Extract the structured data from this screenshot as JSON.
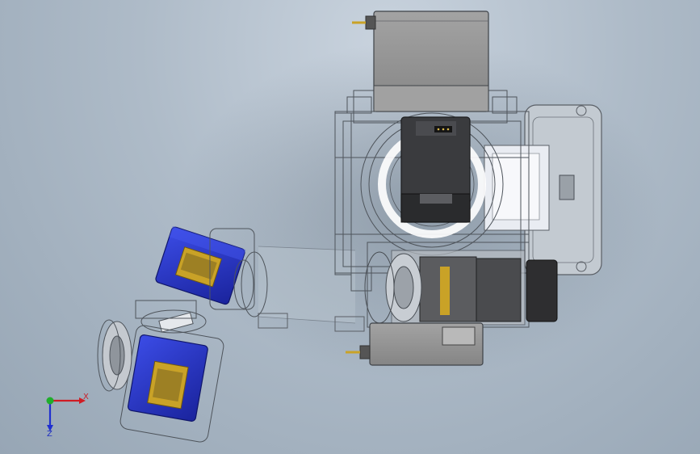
{
  "window": {
    "title": ""
  },
  "triad": {
    "x_label": "X",
    "z_label": "Z",
    "x_color": "#d01c24",
    "y_color": "#1fae2b",
    "z_color": "#1f2fd0"
  },
  "colors": {
    "background": "#aebbc8",
    "servo_blue": "#2233cc",
    "servo_label": "#c9a227",
    "housing_gray": "#8f8f8f",
    "frame_line": "#5a5f66",
    "dark_servo": "#2e2e30"
  }
}
